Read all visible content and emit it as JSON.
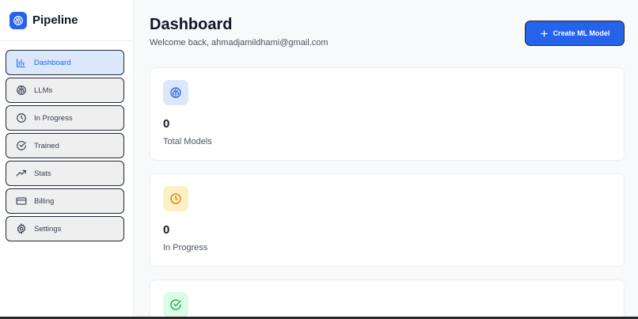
{
  "brand": {
    "name": "Pipeline",
    "icon": "brain-icon",
    "color": "#2563eb"
  },
  "sidebar": {
    "items": [
      {
        "label": "Dashboard",
        "icon": "bar-chart-icon",
        "active": true
      },
      {
        "label": "LLMs",
        "icon": "brain-icon",
        "active": false
      },
      {
        "label": "In Progress",
        "icon": "clock-icon",
        "active": false
      },
      {
        "label": "Trained",
        "icon": "check-circle-icon",
        "active": false
      },
      {
        "label": "Stats",
        "icon": "trending-up-icon",
        "active": false
      },
      {
        "label": "Billing",
        "icon": "credit-card-icon",
        "active": false
      },
      {
        "label": "Settings",
        "icon": "gear-icon",
        "active": false
      }
    ]
  },
  "header": {
    "title": "Dashboard",
    "welcome": "Welcome back, ahmadjamildhami@gmail.com",
    "create_button": "Create ML Model"
  },
  "cards": [
    {
      "value": "0",
      "label": "Total Models",
      "icon": "brain-icon",
      "icon_bg": "#dbe7fb",
      "icon_color": "#2563eb"
    },
    {
      "value": "0",
      "label": "In Progress",
      "icon": "clock-icon",
      "icon_bg": "#fdf0c4",
      "icon_color": "#d97706"
    },
    {
      "value": "",
      "label": "",
      "icon": "check-circle-icon",
      "icon_bg": "#dcfce7",
      "icon_color": "#16a34a"
    }
  ],
  "colors": {
    "accent": "#2563eb",
    "active_nav_bg": "#dbe7fb"
  }
}
